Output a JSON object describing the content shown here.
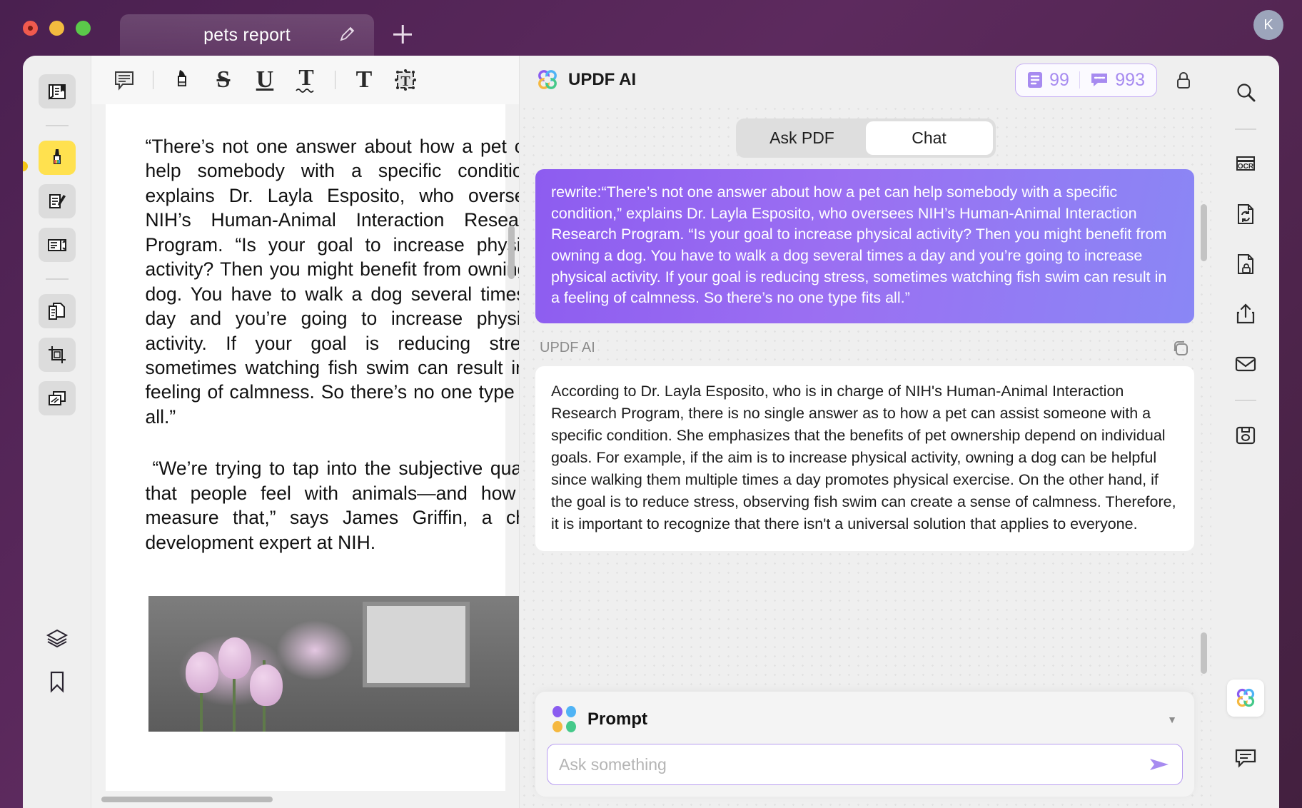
{
  "window": {
    "traffic_lights": [
      "close",
      "minimize",
      "zoom"
    ],
    "tab_title": "pets report",
    "rename_icon": "pencil-icon",
    "new_tab_icon": "plus-icon",
    "avatar_initial": "K"
  },
  "left_rail": {
    "items": [
      {
        "name": "sidebar-item-reader",
        "icon": "book-reader-icon",
        "active": false
      },
      {
        "name": "sidebar-item-comment",
        "icon": "highlighter-icon",
        "active": true
      },
      {
        "name": "sidebar-item-edit-pdf",
        "icon": "page-pencil-icon",
        "active": false
      },
      {
        "name": "sidebar-item-form",
        "icon": "form-field-icon",
        "active": false
      },
      {
        "name": "sidebar-item-organize",
        "icon": "pages-copy-icon",
        "active": false
      },
      {
        "name": "sidebar-item-crop",
        "icon": "crop-icon",
        "active": false
      },
      {
        "name": "sidebar-item-batch",
        "icon": "stacked-pages-icon",
        "active": false
      }
    ],
    "bottom_items": [
      {
        "name": "sidebar-item-layers",
        "icon": "layers-icon"
      },
      {
        "name": "sidebar-item-bookmark",
        "icon": "bookmark-icon"
      }
    ]
  },
  "doc_toolbar": {
    "tools": [
      {
        "name": "tool-sticky-note",
        "icon": "comment-icon",
        "glyph": ""
      },
      {
        "name": "tool-highlight",
        "icon": "highlighter-pen-icon",
        "glyph": ""
      },
      {
        "name": "tool-strikethrough",
        "icon": "strikethrough-icon",
        "glyph": "S"
      },
      {
        "name": "tool-underline",
        "icon": "underline-icon",
        "glyph": "U"
      },
      {
        "name": "tool-squiggly",
        "icon": "squiggly-underline-icon",
        "glyph": "T"
      },
      {
        "name": "tool-text",
        "icon": "text-icon",
        "glyph": "T"
      },
      {
        "name": "tool-text-box",
        "icon": "text-box-icon",
        "glyph": "T"
      }
    ]
  },
  "document": {
    "paragraph_1": "“There’s not one answer about how a pet can help somebody with a specific condition,” explains Dr. Layla Esposito, who oversees NIH’s Human-Animal Interaction Research Program. “Is your goal to increase physical activity? Then you might benefit from owning a dog. You have to walk a dog several times a day and you’re going to increase physical activity. If your goal is reducing stress, sometimes watching fish swim can result in a feeling of calmness. So there’s no one type fits all.”",
    "paragraph_2": "“We’re trying to tap into the subjective quality that people feel with animals—and how to measure that,” says James Griffin, a child development expert at NIH.",
    "image_caption": "photo of tulips and a cat near a picture frame"
  },
  "ai_panel": {
    "logo_icon": "updf-ai-clover-icon",
    "title": "UPDF AI",
    "credits": {
      "pages_icon": "document-pages-icon",
      "pages_value": "99",
      "chat_icon": "chat-bubble-icon",
      "chat_value": "993"
    },
    "lock_icon": "lock-icon",
    "tabs": [
      {
        "name": "tab-ask-pdf",
        "label": "Ask PDF",
        "active": false
      },
      {
        "name": "tab-chat",
        "label": "Chat",
        "active": true
      }
    ],
    "user_message": "rewrite:“There’s not one answer about how a pet can help somebody with a specific condition,” explains Dr. Layla Esposito, who oversees NIH’s Human-Animal Interaction Research Program. “Is your goal to increase physical activity? Then you might benefit from owning a dog. You have to walk a dog several times a day and you’re going to increase physical activity. If your goal is reducing stress, sometimes watching fish swim can result in a feeling of calmness. So there’s no one type fits all.”",
    "assistant_label": "UPDF AI",
    "copy_icon": "copy-icon",
    "assistant_message": "According to Dr. Layla Esposito, who is in charge of NIH's Human-Animal Interaction Research Program, there is no single answer as to how a pet can assist someone with a specific condition. She emphasizes that the benefits of pet ownership depend on individual goals. For example, if the aim is to increase physical activity, owning a dog can be helpful since walking them multiple times a day promotes physical exercise. On the other hand, if the goal is to reduce stress, observing fish swim can create a sense of calmness. Therefore, it is important to recognize that there isn't a universal solution that applies to everyone.",
    "prompt": {
      "dots_icon": "four-dots-icon",
      "label": "Prompt",
      "caret_icon": "chevron-down-icon",
      "input_value": "",
      "input_placeholder": "Ask something",
      "send_icon": "send-arrow-icon"
    }
  },
  "right_rail": {
    "items": [
      {
        "name": "toolbar-search",
        "icon": "search-icon"
      },
      {
        "name": "toolbar-ocr",
        "icon": "ocr-icon"
      },
      {
        "name": "toolbar-convert",
        "icon": "convert-page-icon"
      },
      {
        "name": "toolbar-protect",
        "icon": "page-lock-icon"
      },
      {
        "name": "toolbar-share",
        "icon": "share-upload-icon"
      },
      {
        "name": "toolbar-email",
        "icon": "envelope-icon"
      },
      {
        "name": "toolbar-save",
        "icon": "floppy-save-icon"
      }
    ],
    "bottom_items": [
      {
        "name": "toolbar-updf-ai",
        "icon": "updf-ai-clover-icon",
        "selected": true
      },
      {
        "name": "toolbar-comments",
        "icon": "comment-list-icon",
        "selected": false
      }
    ]
  },
  "colors": {
    "window_chrome": "#4a2050",
    "accent_purple": "#8d5cf0",
    "credit_purple": "#a78bf0",
    "highlight_yellow": "#ffe14f",
    "panel_bg": "#efefef"
  }
}
